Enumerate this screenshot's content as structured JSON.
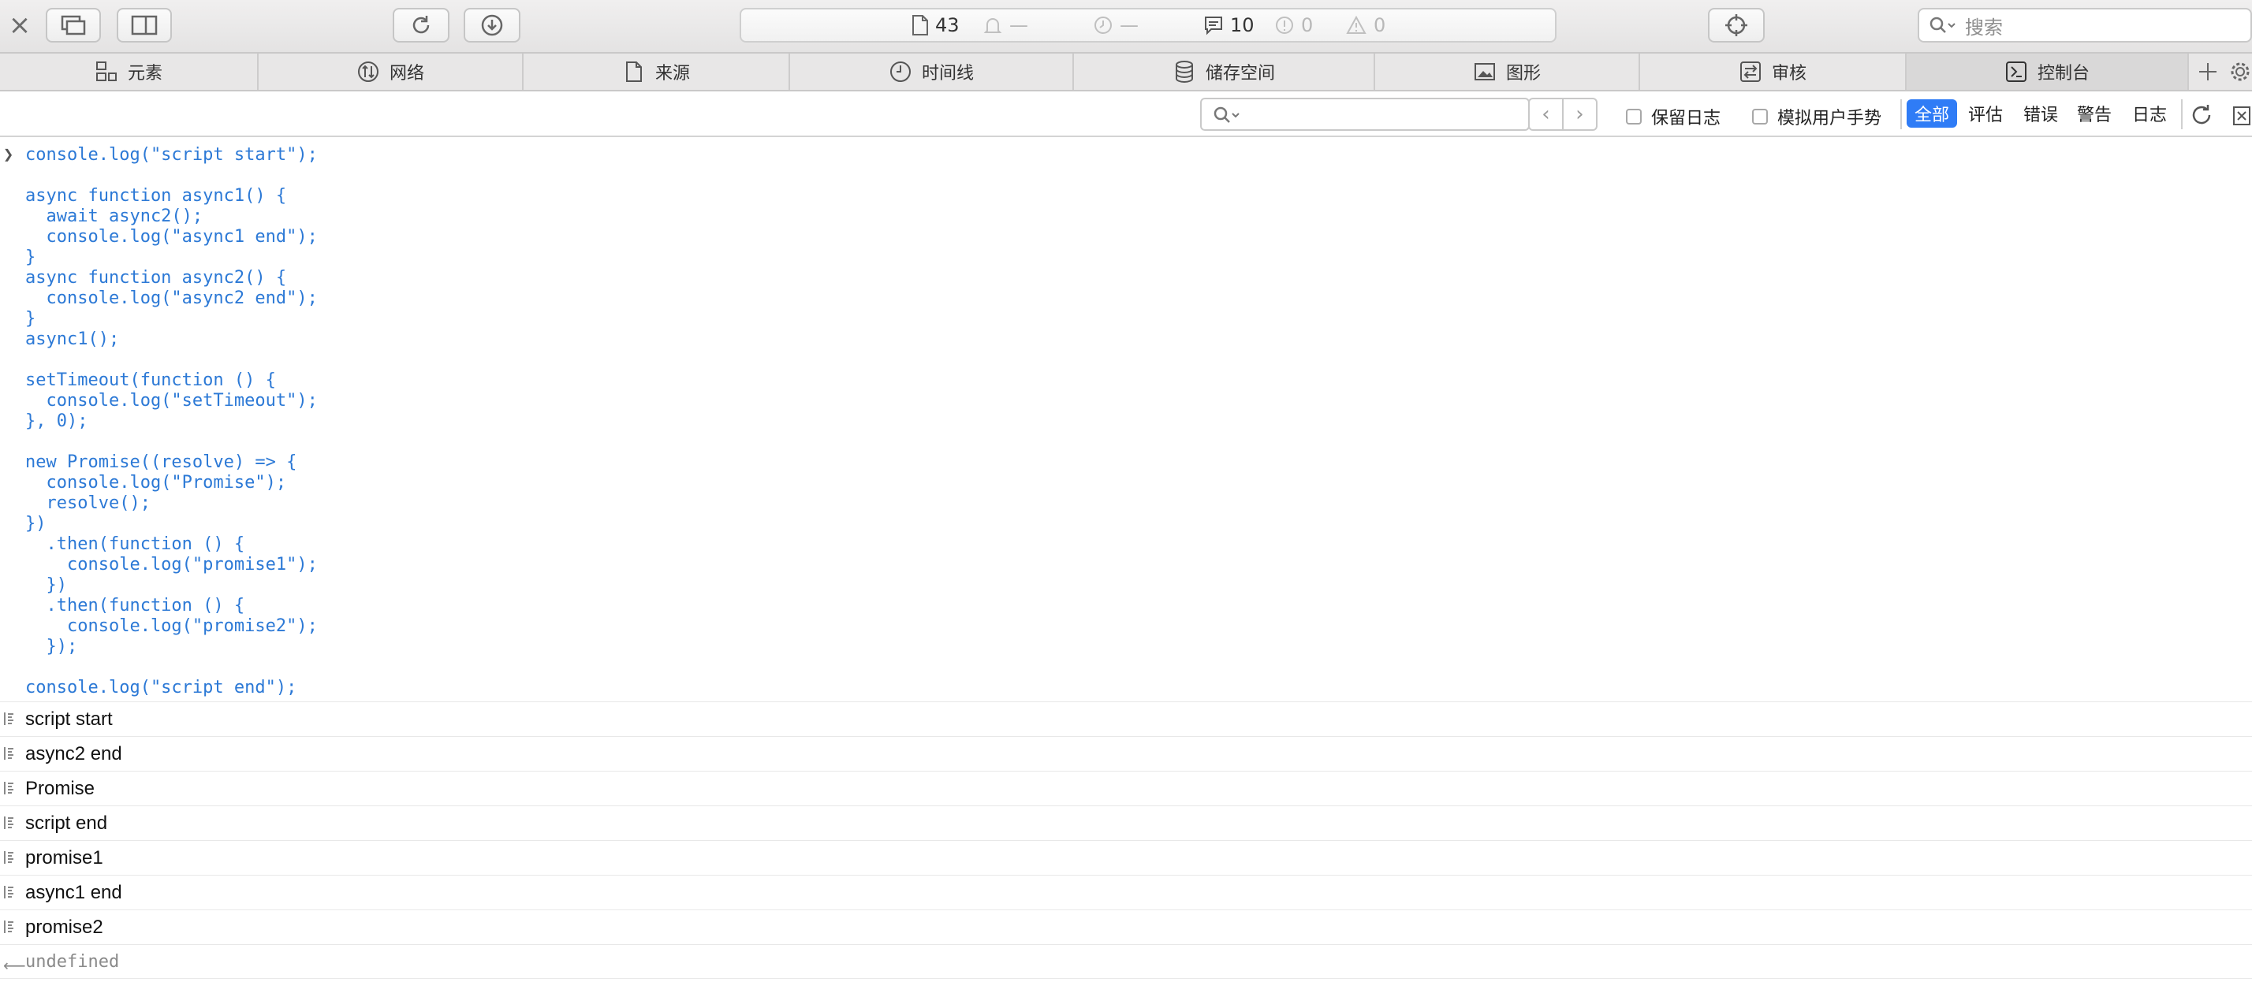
{
  "toolbar": {
    "close_glyph": "×",
    "activity": {
      "resources": "43",
      "warnings_missing": "—",
      "time_missing": "—",
      "logs": "10",
      "errors": "0",
      "issues": "0"
    },
    "search_placeholder": "搜索"
  },
  "tabs": [
    {
      "label": "元素",
      "icon": "elements-icon"
    },
    {
      "label": "网络",
      "icon": "network-icon"
    },
    {
      "label": "来源",
      "icon": "sources-icon"
    },
    {
      "label": "时间线",
      "icon": "timeline-icon"
    },
    {
      "label": "储存空间",
      "icon": "storage-icon"
    },
    {
      "label": "图形",
      "icon": "graphics-icon"
    },
    {
      "label": "审核",
      "icon": "audit-icon"
    },
    {
      "label": "控制台",
      "icon": "console-icon",
      "active": true
    }
  ],
  "filter": {
    "preserve_log": "保留日志",
    "emulate_gesture": "模拟用户手势",
    "levels": [
      "全部",
      "评估",
      "错误",
      "警告",
      "日志"
    ],
    "active_level": "全部"
  },
  "console": {
    "input_code": "console.log(\"script start\");\n\nasync function async1() {\n  await async2();\n  console.log(\"async1 end\");\n}\nasync function async2() {\n  console.log(\"async2 end\");\n}\nasync1();\n\nsetTimeout(function () {\n  console.log(\"setTimeout\");\n}, 0);\n\nnew Promise((resolve) => {\n  console.log(\"Promise\");\n  resolve();\n})\n  .then(function () {\n    console.log(\"promise1\");\n  })\n  .then(function () {\n    console.log(\"promise2\");\n  });\n\nconsole.log(\"script end\");",
    "logs": [
      "script start",
      "async2 end",
      "Promise",
      "script end",
      "promise1",
      "async1 end",
      "promise2"
    ],
    "result": "undefined"
  },
  "colors": {
    "accent": "#2f7cf6",
    "code": "#2c79d6"
  }
}
